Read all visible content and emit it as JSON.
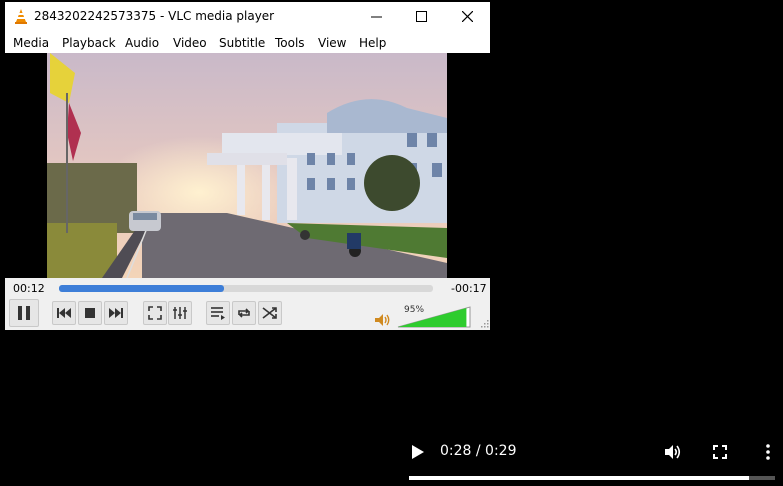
{
  "window": {
    "title": "2843202242573375 - VLC media player",
    "controls": [
      "minimize",
      "maximize",
      "close"
    ]
  },
  "menu": {
    "items": [
      "Media",
      "Playback",
      "Audio",
      "Video",
      "Subtitle",
      "Tools",
      "View",
      "Help"
    ]
  },
  "player": {
    "elapsed": "00:12",
    "remaining": "-00:17",
    "seek_fraction": 0.44,
    "volume_label": "95%",
    "volume_fraction": 0.95,
    "accent_color": "#3d7ed8",
    "volume_color": "#2ecc2e"
  },
  "icons": {
    "pause": "pause-icon",
    "previous": "skip-previous-icon",
    "stop": "stop-icon",
    "next": "skip-next-icon",
    "fullscreen": "fullscreen-icon",
    "extended": "extended-settings-icon",
    "playlist": "playlist-icon",
    "loop": "loop-icon",
    "random": "shuffle-icon",
    "mute": "speaker-icon"
  },
  "browser_controls": {
    "time": "0:28 / 0:29",
    "progress_fraction": 0.93,
    "icons": [
      "play-icon",
      "volume-icon",
      "fullscreen-icon",
      "more-options-icon"
    ]
  }
}
